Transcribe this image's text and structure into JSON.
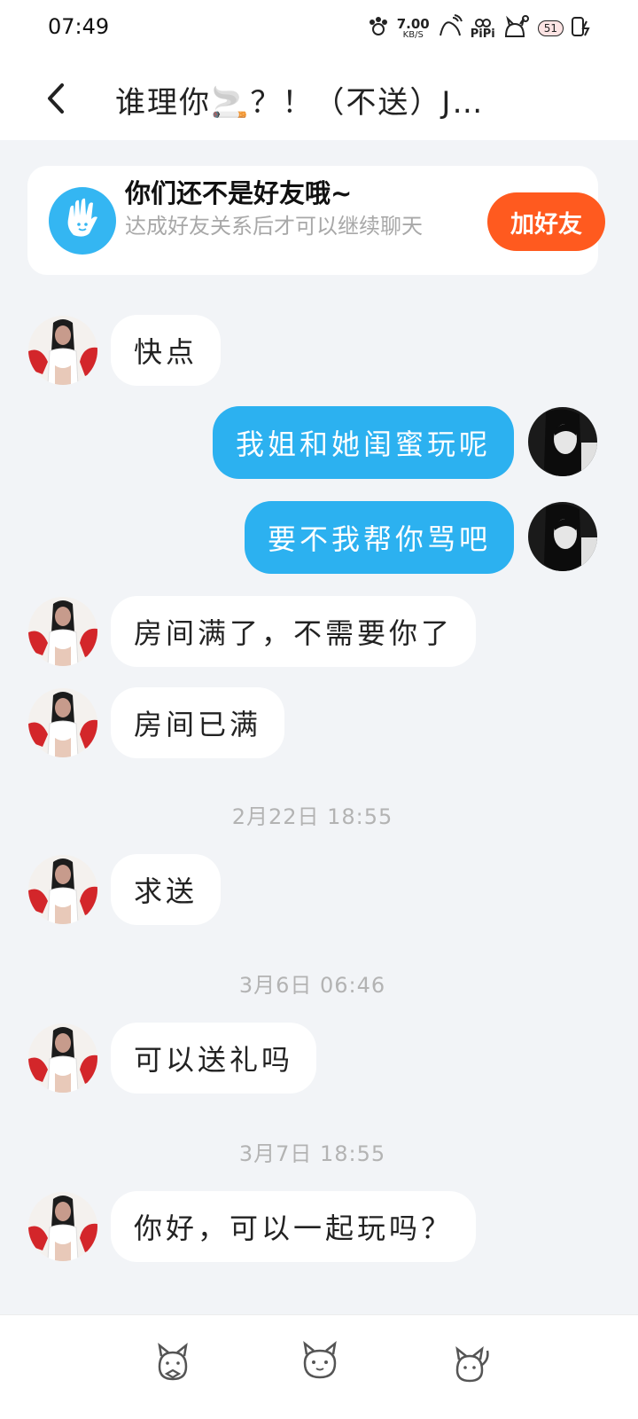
{
  "status_bar": {
    "time": "07:49",
    "net_speed_value": "7.00",
    "net_speed_unit": "KB/S",
    "app_label": "PiPi",
    "badge_number": "51"
  },
  "header": {
    "title": "谁理你🚬？！（不送）J…"
  },
  "friend_notice": {
    "title": "你们还不是好友哦~",
    "description": "达成好友关系后才可以继续聊天",
    "button_label": "加好友"
  },
  "messages": [
    {
      "side": "in",
      "text": "快点"
    },
    {
      "side": "out",
      "text": "我姐和她闺蜜玩呢"
    },
    {
      "side": "out",
      "text": "要不我帮你骂吧"
    },
    {
      "side": "in",
      "text": "房间满了，不需要你了"
    },
    {
      "side": "in",
      "text": "房间已满"
    },
    {
      "type": "timestamp",
      "text": "2月22日 18:55"
    },
    {
      "side": "in",
      "text": "求送"
    },
    {
      "type": "timestamp",
      "text": "3月6日 06:46"
    },
    {
      "side": "in",
      "text": "可以送礼吗"
    },
    {
      "type": "timestamp",
      "text": "3月7日 18:55"
    },
    {
      "side": "in",
      "text": "你好，可以一起玩吗？"
    }
  ],
  "colors": {
    "background": "#f2f4f7",
    "outgoing_bubble": "#2cb1f0",
    "incoming_bubble": "#ffffff",
    "add_friend_button": "#ff5a1f",
    "card_icon": "#34b6f2"
  },
  "bottom_bar": {
    "icons": [
      "cat-with-bow-icon",
      "cat-face-icon",
      "cat-waving-icon"
    ]
  }
}
